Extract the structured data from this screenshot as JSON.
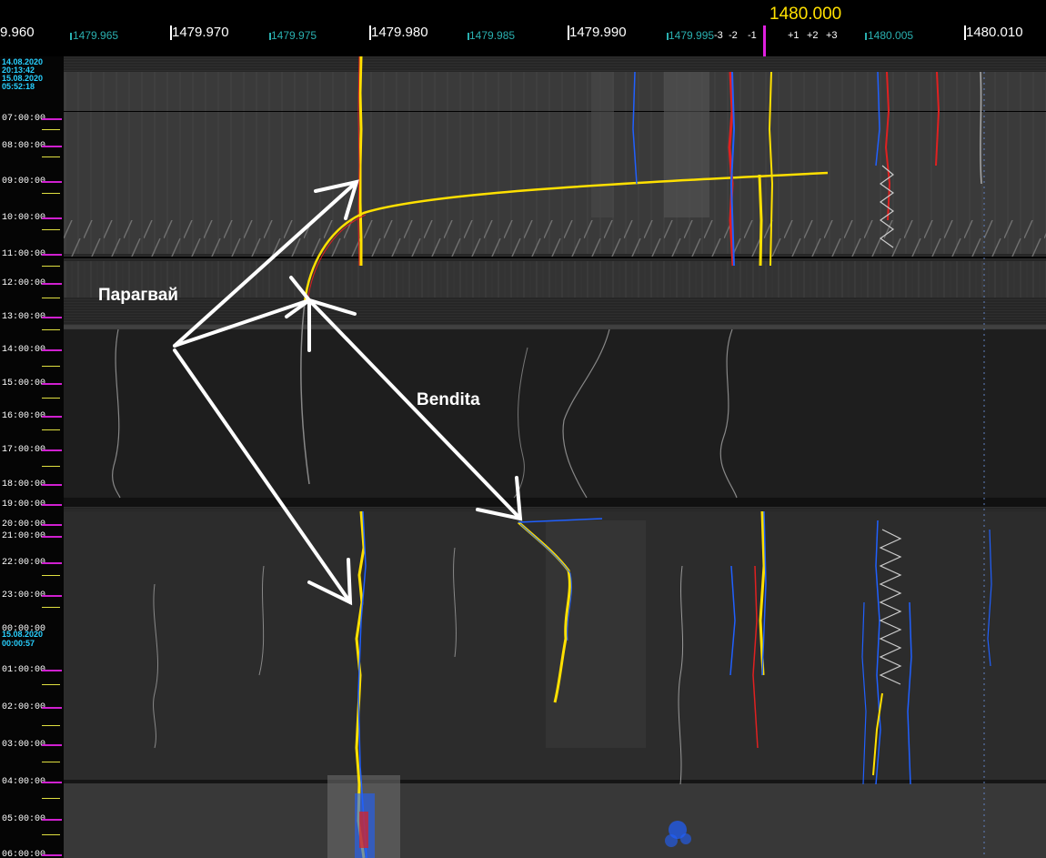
{
  "frequency_axis": {
    "major_labels": [
      "9.960",
      "1479.970",
      "1479.980",
      "1479.990",
      "1480.010"
    ],
    "minor_labels": [
      "1479.965",
      "1479.975",
      "1479.985",
      "1479.995",
      "1480.005"
    ],
    "center_label": "1480.000",
    "offset_labels": [
      "-3",
      "-2",
      "-1",
      "+1",
      "+2",
      "+3"
    ]
  },
  "time_axis": {
    "date_stamps": [
      "14.08.2020",
      "20:13:42",
      "15.08.2020",
      "05:52:18"
    ],
    "hour_labels": [
      "07:00:00",
      "08:00:00",
      "09:00:00",
      "10:00:00",
      "11:00:00",
      "12:00:00",
      "13:00:00",
      "14:00:00",
      "15:00:00",
      "16:00:00",
      "17:00:00",
      "18:00:00",
      "19:00:00",
      "20:00:00",
      "21:00:00",
      "22:00:00",
      "23:00:00",
      "00:00:00",
      "01:00:00",
      "02:00:00",
      "03:00:00",
      "04:00:00",
      "05:00:00",
      "06:00:00"
    ],
    "midnight_stamps": [
      "15.08.2020",
      "00:00:57"
    ]
  },
  "annotations": {
    "paraguay": "Парагвай",
    "bendita": "Bendita"
  },
  "colors": {
    "background": "#262626",
    "trace_hot": "#ffe000",
    "trace_mid": "#e02020",
    "trace_cool": "#2060ff",
    "minor_tick": "#2ab0b0",
    "center_marker": "#e020e0",
    "center_label": "#ffe000"
  }
}
